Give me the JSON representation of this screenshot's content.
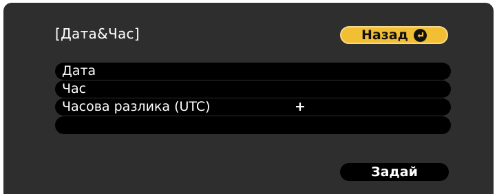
{
  "header": {
    "title": "[Дата&Час]",
    "back_label": "Назад",
    "back_icon": "enter-return-icon"
  },
  "rows": [
    {
      "label": "Дата"
    },
    {
      "label": "Час"
    },
    {
      "label": "Часова разлика (UTC)",
      "value": "+"
    },
    {
      "label": ""
    }
  ],
  "footer": {
    "set_label": "Задай"
  },
  "colors": {
    "panel": "#2e2e2e",
    "accent": "#f2be33",
    "row": "#000000",
    "text": "#ffffff"
  }
}
